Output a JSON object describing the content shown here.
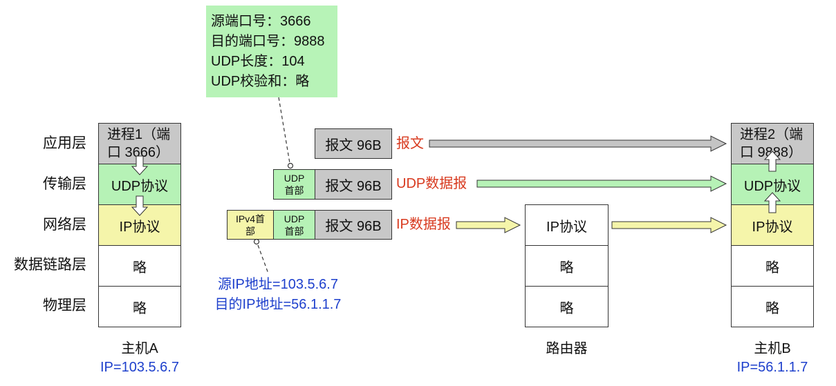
{
  "layers": [
    "应用层",
    "传输层",
    "网络层",
    "数据链路层",
    "物理层"
  ],
  "host_a": {
    "rows": [
      "进程1（端口 3666）",
      "UDP协议",
      "IP协议",
      "略",
      "略"
    ],
    "name": "主机A",
    "ip": "IP=103.5.6.7"
  },
  "router": {
    "rows": [
      "IP协议",
      "略",
      "略"
    ],
    "name": "路由器"
  },
  "host_b": {
    "rows": [
      "进程2（端口 9888）",
      "UDP协议",
      "IP协议",
      "略",
      "略"
    ],
    "name": "主机B",
    "ip": "IP=56.1.1.7"
  },
  "udp_header_info": [
    "源端口号：3666",
    "目的端口号：9888",
    "UDP长度：104",
    "UDP校验和：略"
  ],
  "ip_header_info": [
    "源IP地址=103.5.6.7",
    "目的IP地址=56.1.1.7"
  ],
  "packets": {
    "message": {
      "payload": "报文 96B",
      "label": "报文"
    },
    "udp": {
      "udp_header": "UDP首部",
      "payload": "报文 96B",
      "label": "UDP数据报"
    },
    "ip": {
      "ip_header": "IPv4首部",
      "udp_header": "UDP首部",
      "payload": "报文 96B",
      "label": "IP数据报"
    }
  },
  "colors": {
    "process": "#c8c8c8",
    "udp": "#b6f2b6",
    "ip": "#f5f5aa",
    "label_red": "#d83a1f",
    "ip_blue": "#1d3fcc",
    "header_note": "#b7f3b7"
  }
}
